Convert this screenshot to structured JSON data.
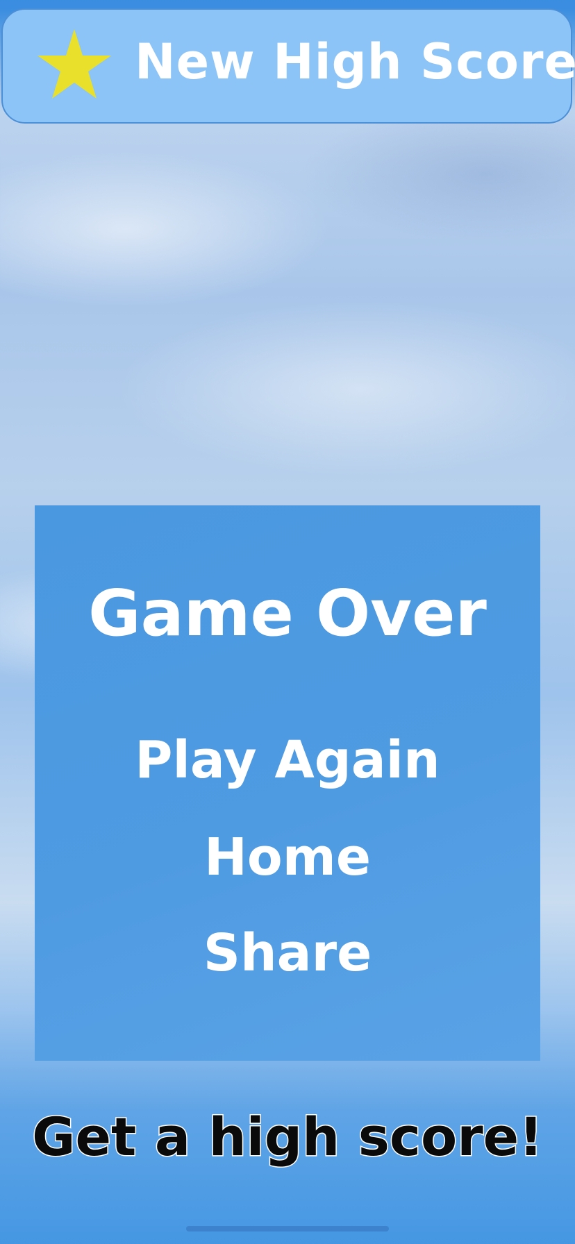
{
  "banner": {
    "icon": "star-icon",
    "icon_color": "#e8e02a",
    "text": "New High Score!"
  },
  "panel": {
    "title": "Game Over",
    "buttons": {
      "play_again": "Play Again",
      "home": "Home",
      "share": "Share"
    }
  },
  "footer": {
    "prompt": "Get a high score!"
  },
  "colors": {
    "banner_background": "#8cc4f7",
    "panel_background": "#4f9be2",
    "text_light": "#ffffff",
    "text_dark": "#0a0a0a"
  }
}
